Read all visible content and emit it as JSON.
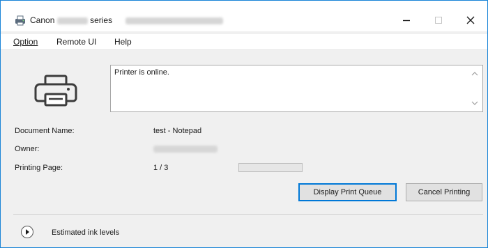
{
  "window": {
    "title_brand": "Canon",
    "title_series": "series"
  },
  "menu": {
    "option": "Option",
    "remote_ui": "Remote UI",
    "help": "Help"
  },
  "status": {
    "message": "Printer is online."
  },
  "job": {
    "document_label": "Document Name:",
    "document_value": "test - Notepad",
    "owner_label": "Owner:",
    "page_label": "Printing Page:",
    "page_value": "1 / 3",
    "progress": 0
  },
  "buttons": {
    "display_queue": "Display Print Queue",
    "cancel_printing": "Cancel Printing"
  },
  "ink": {
    "label": "Estimated ink levels"
  },
  "icons": {
    "app": "canon-printer-app-icon",
    "printer": "printer-icon",
    "expand": "expand-arrow-icon"
  },
  "colors": {
    "window_border": "#1883d7",
    "default_button_border": "#0078d7",
    "dialog_bg": "#f0f0f0"
  }
}
